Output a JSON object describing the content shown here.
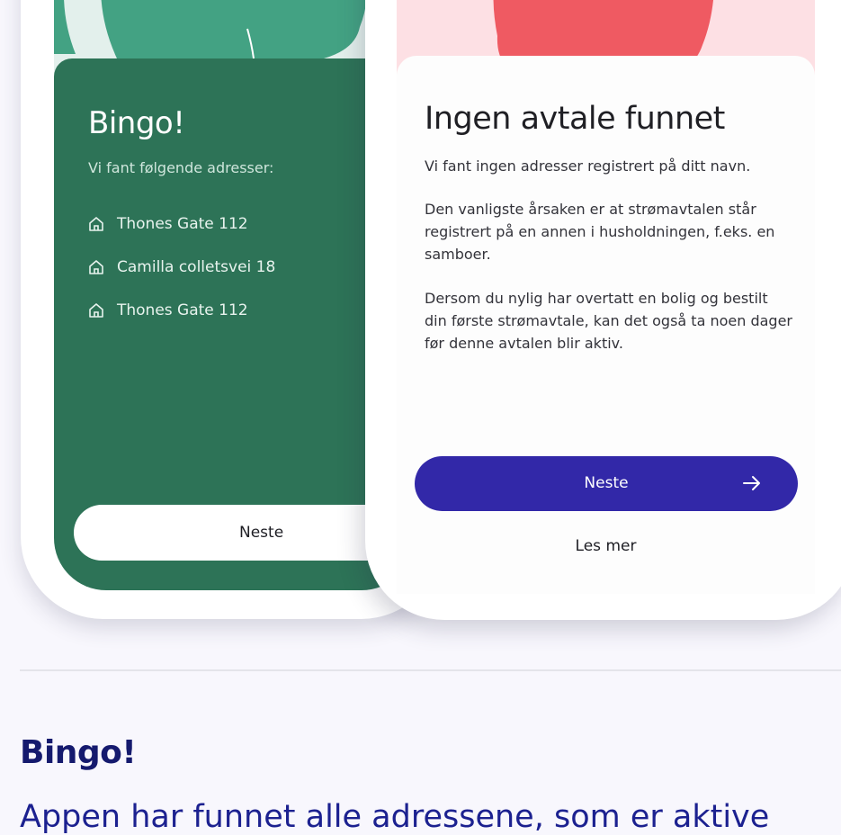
{
  "left_phone": {
    "title": "Bingo!",
    "subtitle": "Vi fant følgende adresser:",
    "addresses": [
      "Thones Gate 112",
      "Camilla colletsvei 18",
      "Thones Gate 112"
    ],
    "next_label": "Neste"
  },
  "right_phone": {
    "title": "Ingen avtale funnet",
    "paragraph_1": "Vi fant ingen adresser registrert på ditt navn.",
    "paragraph_2": "Den vanligste årsaken er at strømavtalen står registrert på en annen i husholdningen, f.eks. en samboer.",
    "paragraph_3": "Dersom du nylig har overtatt en bolig og bestilt din første strømavtale, kan det også ta noen dager før denne avtalen blir aktiv.",
    "next_label": "Neste",
    "read_more_label": "Les mer"
  },
  "article": {
    "heading": "Bingo!",
    "body": "Appen har funnet alle adressene, som er aktive"
  },
  "colors": {
    "page_background": "#f8f7fd",
    "left_card_green": "#2d7357",
    "left_illustration_green": "#43a283",
    "right_illustration_red": "#ef5a62",
    "right_illustration_pink": "#fde0e4",
    "primary_button": "#3228a8",
    "heading_navy": "#151a6e",
    "body_blue": "#1c2190"
  },
  "icons": {
    "address": "home-icon",
    "next": "arrow-right-icon"
  }
}
